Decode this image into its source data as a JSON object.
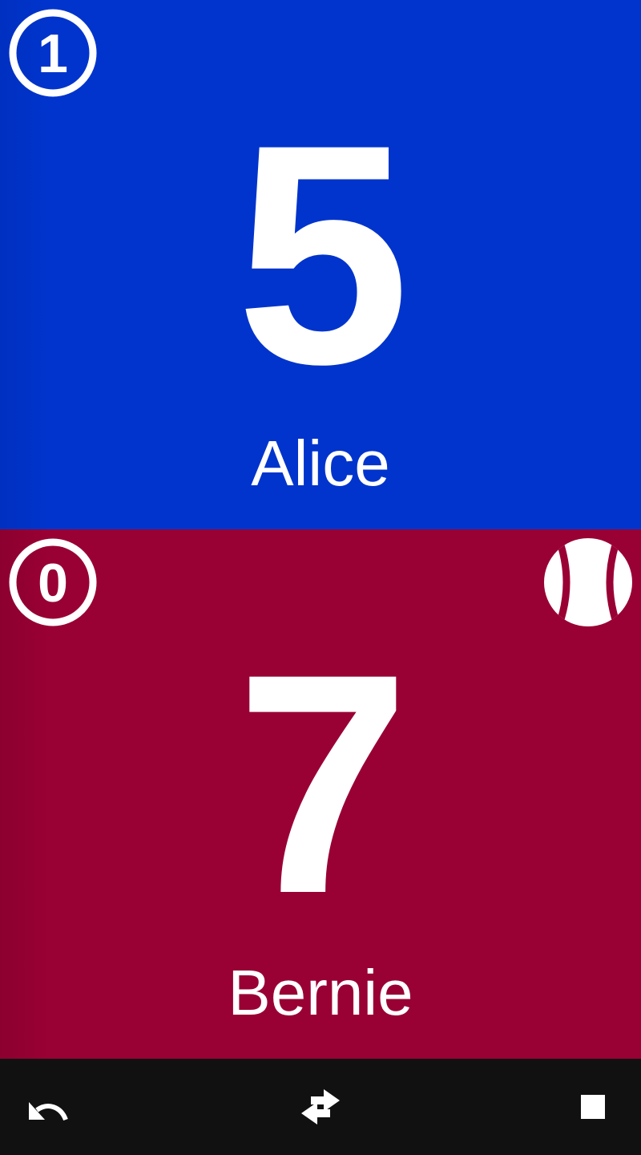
{
  "players": [
    {
      "name": "Alice",
      "score": "5",
      "sets": "1",
      "serving": false,
      "color": "#0034cc"
    },
    {
      "name": "Bernie",
      "score": "7",
      "sets": "0",
      "serving": true,
      "color": "#990033"
    }
  ],
  "navbar": {
    "buttons": [
      {
        "icon": "undo-icon"
      },
      {
        "icon": "swap-icon"
      },
      {
        "icon": "stop-icon"
      }
    ]
  }
}
